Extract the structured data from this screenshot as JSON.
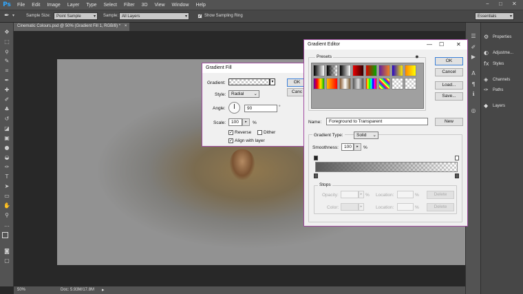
{
  "menubar": {
    "logo": "Ps",
    "items": [
      "File",
      "Edit",
      "Image",
      "Layer",
      "Type",
      "Select",
      "Filter",
      "3D",
      "View",
      "Window",
      "Help"
    ],
    "window_controls": [
      "−",
      "□",
      "✕"
    ]
  },
  "options": {
    "sample_size_label": "Sample Size:",
    "sample_size_value": "Point Sample",
    "sample_label": "Sample:",
    "sample_value": "All Layers",
    "show_ring_label": "Show Sampling Ring",
    "workspace": "Essentials"
  },
  "document": {
    "tab_title": "Cinematic Colours.psd @ 50% (Gradient Fill 1, RGB/8) *",
    "close": "×"
  },
  "status": {
    "zoom": "50%",
    "doc_size": "Doc: 5.93M/17.8M"
  },
  "panels": {
    "items": [
      "Properties",
      "Adjustme...",
      "Styles",
      "Channels",
      "Paths",
      "Layers"
    ]
  },
  "gradient_fill": {
    "title": "Gradient Fill",
    "gradient_label": "Gradient:",
    "style_label": "Style:",
    "style_value": "Radial",
    "angle_label": "Angle:",
    "angle_value": "90",
    "angle_unit": "°",
    "scale_label": "Scale:",
    "scale_value": "100",
    "scale_unit": "%",
    "reverse_label": "Reverse",
    "reverse_checked": true,
    "dither_label": "Dither",
    "dither_checked": false,
    "align_label": "Align with layer",
    "align_checked": true,
    "ok_label": "OK",
    "cancel_label": "Canc"
  },
  "gradient_editor": {
    "title": "Gradient Editor",
    "presets_label": "Presets",
    "ok_label": "OK",
    "cancel_label": "Cancel",
    "load_label": "Load...",
    "save_label": "Save...",
    "name_label": "Name:",
    "name_value": "Foreground to Transparent",
    "new_label": "New",
    "gradient_type_label": "Gradient Type:",
    "gradient_type_value": "Solid",
    "smoothness_label": "Smoothness:",
    "smoothness_value": "100",
    "smoothness_unit": "%",
    "stops_label": "Stops",
    "opacity_label": "Opacity:",
    "opacity_unit": "%",
    "location_label": "Location:",
    "location_unit": "%",
    "color_label": "Color:",
    "delete_label": "Delete"
  },
  "colors": {
    "accent_blue": "#3a7fd8",
    "dialog_border": "#a04aa0",
    "app_dark": "#282828",
    "app_panel": "#535353"
  }
}
